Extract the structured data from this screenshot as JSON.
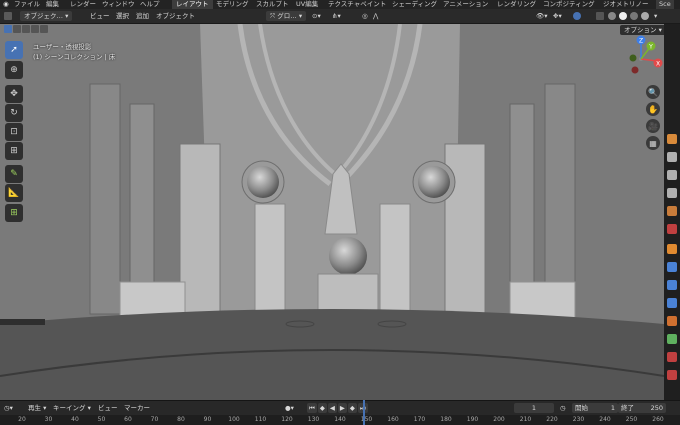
{
  "menu": {
    "file": "ファイル",
    "edit": "編集",
    "render": "レンダー",
    "window": "ウィンドウ",
    "help": "ヘルプ"
  },
  "workspace_tabs": [
    "レイアウト",
    "モデリング",
    "スカルプト",
    "UV編集",
    "テクスチャペイント",
    "シェーディング",
    "アニメーション",
    "レンダリング",
    "コンポジティング",
    "ジオメトリノー"
  ],
  "scene_label": "Sce",
  "header": {
    "mode": "オブジェク…",
    "view": "ビュー",
    "select": "選択",
    "add": "追加",
    "object": "オブジェクト",
    "transform_orientation": "グロ…",
    "options": "オプション"
  },
  "viewport": {
    "view_label": "ユーザー・透視投影",
    "collection_label": "(1) シーンコレクション | 床"
  },
  "gizmo": {
    "z": "Z",
    "y": "Y",
    "x": "X"
  },
  "timeline": {
    "playback": "再生",
    "keying": "キーイング",
    "view": "ビュー",
    "marker": "マーカー",
    "current_frame": "1",
    "start_label": "開始",
    "start": "1",
    "end_label": "終了",
    "end": "250"
  },
  "ruler_ticks": [
    "20",
    "30",
    "40",
    "50",
    "60",
    "70",
    "80",
    "90",
    "100",
    "110",
    "120",
    "130",
    "140",
    "150",
    "160",
    "170",
    "180",
    "190",
    "200",
    "210",
    "220",
    "230",
    "240",
    "250",
    "260"
  ],
  "colors": {
    "accent": "#4772b3",
    "x_axis": "#e24a4a",
    "y_axis": "#7bb62b",
    "z_axis": "#3d7ee8"
  }
}
